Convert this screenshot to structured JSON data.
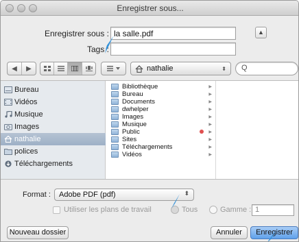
{
  "window": {
    "title": "Enregistrer sous..."
  },
  "save_as": {
    "label": "Enregistrer sous :",
    "filename": "la salle.pdf",
    "tags_label": "Tags :",
    "tags_value": ""
  },
  "toolbar": {
    "location": "nathalie",
    "search_placeholder": "Q",
    "icons": [
      "back-icon",
      "forward-icon",
      "icon-view-icon",
      "list-view-icon",
      "column-view-icon",
      "coverflow-icon",
      "arrange-icon",
      "home-icon"
    ]
  },
  "sidebar": {
    "items": [
      {
        "label": "Bureau",
        "icon": "desktop-icon"
      },
      {
        "label": "Vidéos",
        "icon": "movies-icon"
      },
      {
        "label": "Musique",
        "icon": "music-icon"
      },
      {
        "label": "Images",
        "icon": "camera-icon"
      },
      {
        "label": "nathalie",
        "icon": "home-icon",
        "selected": true
      },
      {
        "label": "polices",
        "icon": "folder-icon"
      },
      {
        "label": "Téléchargements",
        "icon": "download-icon"
      }
    ]
  },
  "files": {
    "items": [
      {
        "label": "Bibliothèque"
      },
      {
        "label": "Bureau"
      },
      {
        "label": "Documents"
      },
      {
        "label": "dwhelper"
      },
      {
        "label": "Images"
      },
      {
        "label": "Musique"
      },
      {
        "label": "Public",
        "tag_color": "#e05050"
      },
      {
        "label": "Sites"
      },
      {
        "label": "Téléchargements"
      },
      {
        "label": "Vidéos"
      }
    ]
  },
  "options": {
    "format_label": "Format :",
    "format_value": "Adobe PDF (pdf)",
    "use_artboards": "Utiliser les plans de travail",
    "all_label": "Tous",
    "range_label": "Gamme :",
    "range_value": "1"
  },
  "buttons": {
    "new_folder": "Nouveau dossier",
    "cancel": "Annuler",
    "save": "Enregistrer"
  },
  "colors": {
    "accent": "#5fa0ea",
    "cursor": "#2f8fd8"
  }
}
